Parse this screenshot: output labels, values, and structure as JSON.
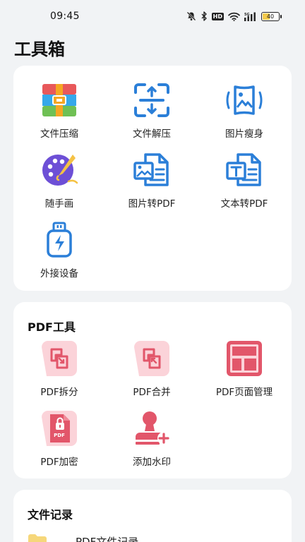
{
  "status_bar": {
    "time": "09:45",
    "battery_level": "40",
    "icons": [
      "mute-bell-icon",
      "bluetooth-icon",
      "hd-icon",
      "wifi-icon",
      "cellular-icon",
      "battery-icon"
    ],
    "hd_label": "HD"
  },
  "page": {
    "title": "工具箱"
  },
  "tools": {
    "items": [
      {
        "label": "文件压缩",
        "icon": "zip-archive-icon"
      },
      {
        "label": "文件解压",
        "icon": "unzip-icon"
      },
      {
        "label": "图片瘦身",
        "icon": "image-compress-icon"
      },
      {
        "label": "随手画",
        "icon": "paint-palette-icon"
      },
      {
        "label": "图片转PDF",
        "icon": "image-to-pdf-icon"
      },
      {
        "label": "文本转PDF",
        "icon": "text-to-pdf-icon"
      },
      {
        "label": "外接设备",
        "icon": "usb-drive-icon"
      }
    ]
  },
  "pdf_tools": {
    "heading": "PDF工具",
    "items": [
      {
        "label": "PDF拆分",
        "icon": "pdf-split-icon"
      },
      {
        "label": "PDF合并",
        "icon": "pdf-merge-icon"
      },
      {
        "label": "PDF页面管理",
        "icon": "pdf-page-manage-icon"
      },
      {
        "label": "PDF加密",
        "icon": "pdf-encrypt-icon"
      },
      {
        "label": "添加水印",
        "icon": "watermark-stamp-icon"
      }
    ],
    "pdf_badge": "PDF"
  },
  "records": {
    "heading": "文件记录",
    "items": [
      {
        "label": "PDF文件记录",
        "icon": "folder-icon"
      }
    ]
  },
  "colors": {
    "background": "#f1f3f5",
    "blue": "#2b7fd8",
    "pdf_red": "#e2566a",
    "pdf_pink_bg": "#fbd3d9"
  }
}
